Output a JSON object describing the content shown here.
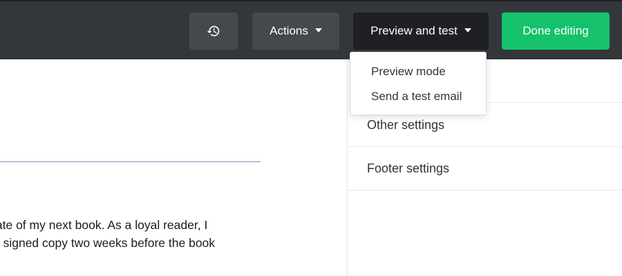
{
  "toolbar": {
    "history_icon": "history-icon",
    "actions_label": "Actions",
    "preview_label": "Preview and test",
    "done_label": "Done editing"
  },
  "preview_menu": {
    "items": [
      {
        "label": "Preview mode"
      },
      {
        "label": "Send a test email"
      }
    ]
  },
  "side_panel": {
    "items": [
      {
        "label": ""
      },
      {
        "label": "Other settings"
      },
      {
        "label": "Footer settings"
      }
    ]
  },
  "editor": {
    "body_lines": [
      "late of my next book. As a loyal reader, I",
      "a signed copy two weeks before the book"
    ]
  },
  "colors": {
    "topbar": "#33373c",
    "done_button": "#15c26b",
    "preview_button": "#1e2023"
  }
}
